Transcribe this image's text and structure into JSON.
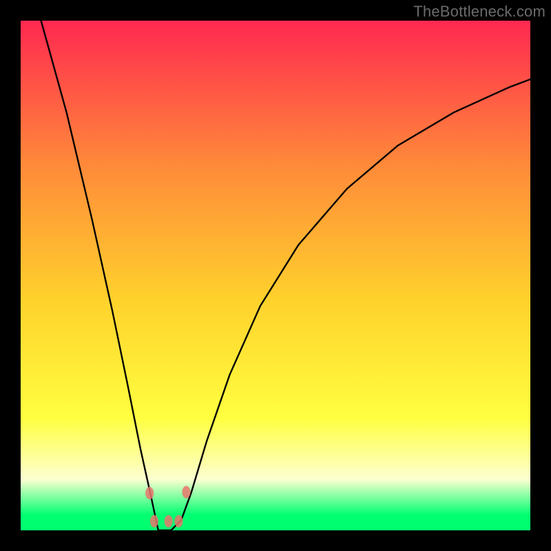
{
  "watermark": "TheBottleneck.com",
  "colors": {
    "frame": "#000000",
    "grad_top": "#ff2850",
    "grad_upper_mid": "#ff893a",
    "grad_mid": "#ffd22c",
    "grad_lower_mid": "#ffff40",
    "grad_pale": "#fcffd0",
    "grad_green": "#00ff70",
    "curve_stroke": "#000000",
    "marker_fill": "#e8766c"
  },
  "chart_data": {
    "type": "line",
    "title": "",
    "xlabel": "",
    "ylabel": "",
    "xlim": [
      0,
      1
    ],
    "ylim": [
      0,
      1
    ],
    "note": "Axes are unlabeled; values are normalized fractions of the plot area (x right, y up). Curve approximates the V/checkmark shape with a flat minimum near x≈0.28.",
    "series": [
      {
        "name": "curve",
        "x": [
          0.04,
          0.09,
          0.14,
          0.18,
          0.21,
          0.235,
          0.255,
          0.27,
          0.295,
          0.315,
          0.335,
          0.365,
          0.41,
          0.47,
          0.545,
          0.64,
          0.74,
          0.85,
          0.96,
          1.0
        ],
        "y": [
          1.0,
          0.82,
          0.61,
          0.43,
          0.285,
          0.16,
          0.07,
          0.0,
          0.0,
          0.02,
          0.075,
          0.175,
          0.305,
          0.44,
          0.56,
          0.67,
          0.755,
          0.82,
          0.87,
          0.885
        ]
      }
    ],
    "markers": {
      "name": "flat-region",
      "points": [
        {
          "x": 0.253,
          "y": 0.073
        },
        {
          "x": 0.262,
          "y": 0.018
        },
        {
          "x": 0.29,
          "y": 0.018
        },
        {
          "x": 0.31,
          "y": 0.018
        },
        {
          "x": 0.325,
          "y": 0.075
        }
      ],
      "rx": 6,
      "ry": 9
    }
  }
}
